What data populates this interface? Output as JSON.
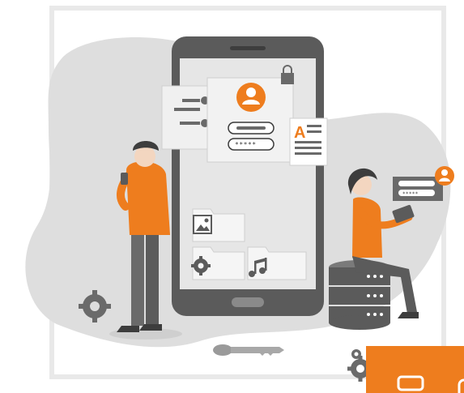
{
  "login_card": {
    "password_mask": "*****"
  },
  "tablet_popup": {
    "password_mask": "*****"
  },
  "document_icon": {
    "letter": "A"
  },
  "colors": {
    "accent_orange": "#ee7d1e",
    "phone_frame": "#5b5b5b",
    "phone_screen": "#e6e6e6",
    "blob_gray": "#dedede",
    "card_bg": "#f2f2f2"
  }
}
